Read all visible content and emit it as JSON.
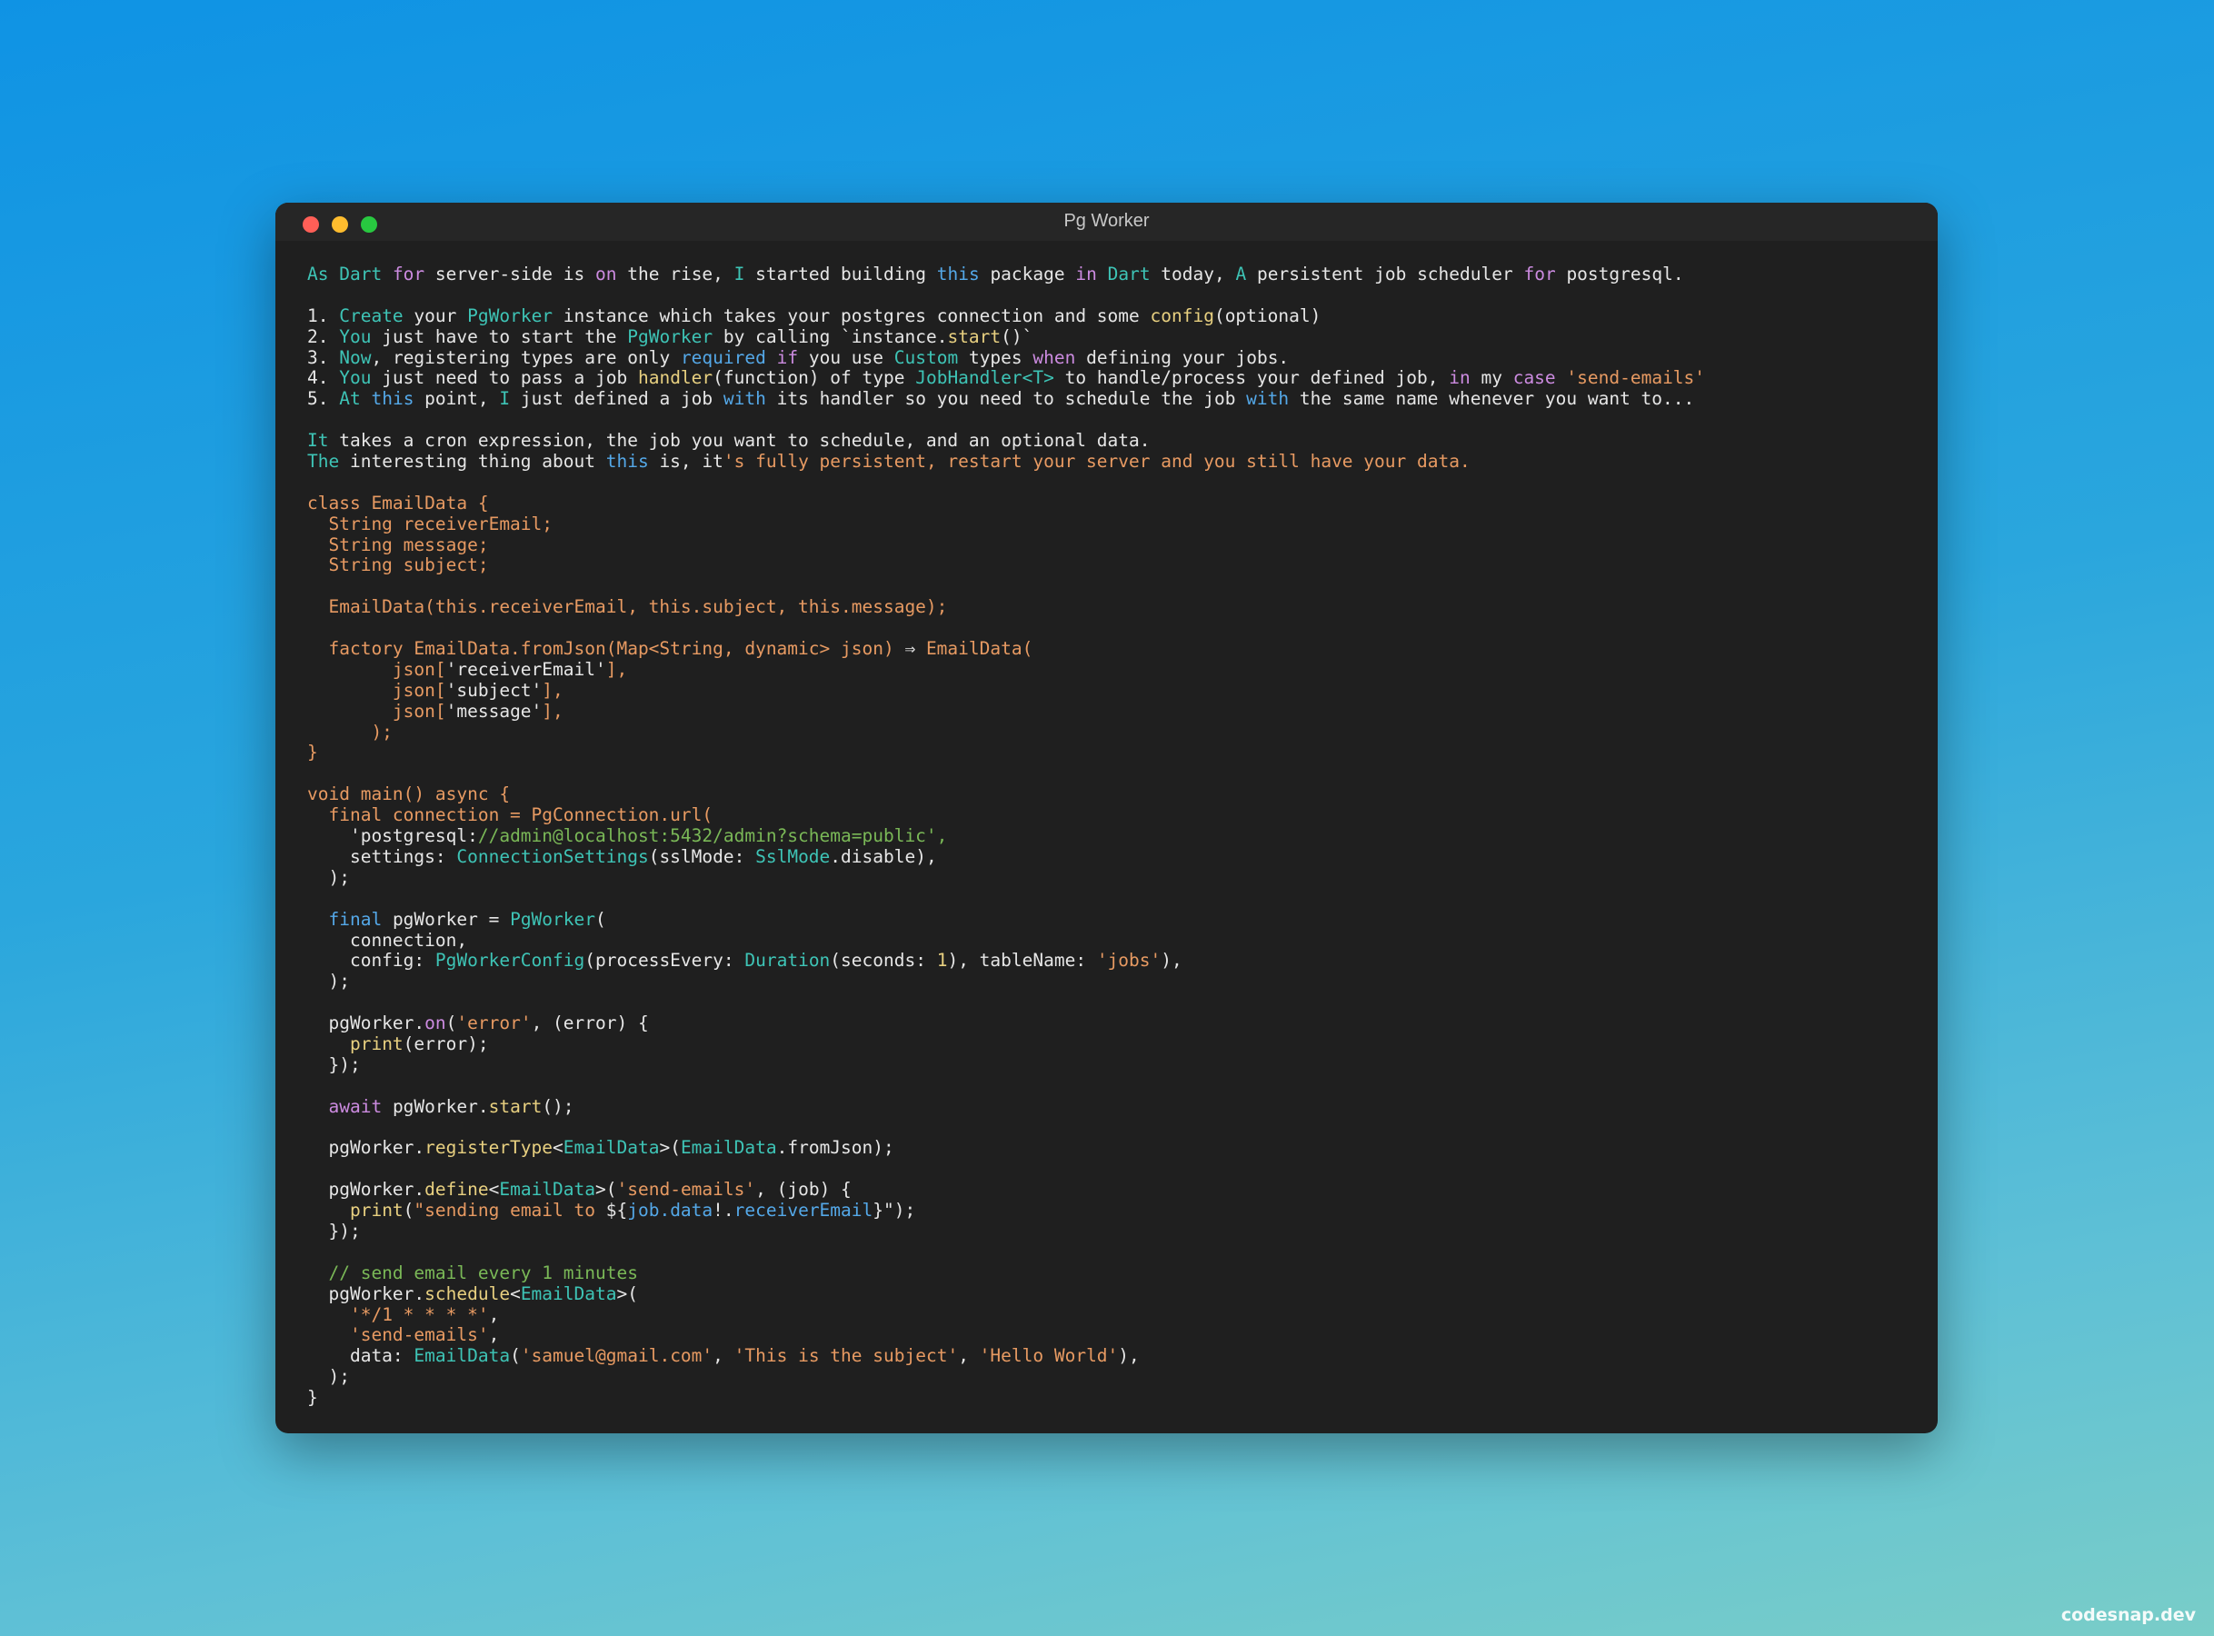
{
  "window": {
    "title": "Pg Worker"
  },
  "watermark": "codesnap.dev",
  "colors": {
    "background_top": "#0f93e4",
    "background_bottom": "#79cdc8",
    "window_bg": "#1f1f1f",
    "close": "#ff5f57",
    "minimize": "#febc2e",
    "maximize": "#28c840",
    "keyword": "#cc8be0",
    "type": "#3ec4b6",
    "string": "#e79a62",
    "comment": "#7ab857"
  },
  "code_lines": [
    [
      [
        "As ",
        "teal"
      ],
      [
        "Dart ",
        "teal"
      ],
      [
        "for ",
        "kw"
      ],
      [
        "server-side is ",
        "white"
      ],
      [
        "on ",
        "kw"
      ],
      [
        "the rise, ",
        "white"
      ],
      [
        "I ",
        "teal"
      ],
      [
        "started building ",
        "white"
      ],
      [
        "this ",
        "blue"
      ],
      [
        "package ",
        "white"
      ],
      [
        "in ",
        "kw"
      ],
      [
        "Dart ",
        "teal"
      ],
      [
        "today, ",
        "white"
      ],
      [
        "A ",
        "teal"
      ],
      [
        "persistent job scheduler ",
        "white"
      ],
      [
        "for ",
        "kw"
      ],
      [
        "postgresql.",
        "white"
      ]
    ],
    [],
    [
      [
        "1. ",
        "white"
      ],
      [
        "Create ",
        "teal"
      ],
      [
        "your ",
        "white"
      ],
      [
        "PgWorker ",
        "teal"
      ],
      [
        "instance which takes your postgres connection and some ",
        "white"
      ],
      [
        "config",
        "yellow"
      ],
      [
        "(optional)",
        "white"
      ]
    ],
    [
      [
        "2. ",
        "white"
      ],
      [
        "You ",
        "teal"
      ],
      [
        "just have to start the ",
        "white"
      ],
      [
        "PgWorker ",
        "teal"
      ],
      [
        "by calling `instance.",
        "white"
      ],
      [
        "start",
        "yellow"
      ],
      [
        "()`",
        "white"
      ]
    ],
    [
      [
        "3. ",
        "white"
      ],
      [
        "Now",
        "teal"
      ],
      [
        ", registering types are only ",
        "white"
      ],
      [
        "required ",
        "blue"
      ],
      [
        "if ",
        "kw"
      ],
      [
        "you use ",
        "white"
      ],
      [
        "Custom ",
        "teal"
      ],
      [
        "types ",
        "white"
      ],
      [
        "when ",
        "kw"
      ],
      [
        "defining your jobs.",
        "white"
      ]
    ],
    [
      [
        "4. ",
        "white"
      ],
      [
        "You ",
        "teal"
      ],
      [
        "just need to pass a job ",
        "white"
      ],
      [
        "handler",
        "yellow"
      ],
      [
        "(function) of type ",
        "white"
      ],
      [
        "JobHandler<T> ",
        "teal"
      ],
      [
        "to handle/process your defined job, ",
        "white"
      ],
      [
        "in ",
        "kw"
      ],
      [
        "my ",
        "white"
      ],
      [
        "case ",
        "kw"
      ],
      [
        "'send-emails'",
        "orange"
      ]
    ],
    [
      [
        "5. ",
        "white"
      ],
      [
        "At ",
        "teal"
      ],
      [
        "this ",
        "blue"
      ],
      [
        "point, ",
        "white"
      ],
      [
        "I ",
        "teal"
      ],
      [
        "just defined a job ",
        "white"
      ],
      [
        "with ",
        "blue"
      ],
      [
        "its handler so you need to schedule the job ",
        "white"
      ],
      [
        "with ",
        "blue"
      ],
      [
        "the same name whenever you want to...",
        "white"
      ]
    ],
    [],
    [
      [
        "It ",
        "teal"
      ],
      [
        "takes a cron expression, the job you want to schedule, and an optional data.",
        "white"
      ]
    ],
    [
      [
        "The ",
        "teal"
      ],
      [
        "interesting thing about ",
        "white"
      ],
      [
        "this ",
        "blue"
      ],
      [
        "is, it",
        "white"
      ],
      [
        "'s fully persistent, restart your server and you still have your data.",
        "orange"
      ]
    ],
    [],
    [
      [
        "class EmailData {",
        "orange"
      ]
    ],
    [
      [
        "  String receiverEmail;",
        "orange"
      ]
    ],
    [
      [
        "  String message;",
        "orange"
      ]
    ],
    [
      [
        "  String subject;",
        "orange"
      ]
    ],
    [],
    [
      [
        "  EmailData(this.receiverEmail, this.subject, this.message);",
        "orange"
      ]
    ],
    [],
    [
      [
        "  factory EmailData.fromJson(Map<String, dynamic> json) ",
        "orange"
      ],
      [
        "⇒ ",
        "white"
      ],
      [
        "EmailData(",
        "orange"
      ]
    ],
    [
      [
        "        json[",
        "orange"
      ],
      [
        "'receiverEmail'",
        "white"
      ],
      [
        "],",
        "orange"
      ]
    ],
    [
      [
        "        json[",
        "orange"
      ],
      [
        "'subject'",
        "white"
      ],
      [
        "],",
        "orange"
      ]
    ],
    [
      [
        "        json[",
        "orange"
      ],
      [
        "'message'",
        "white"
      ],
      [
        "],",
        "orange"
      ]
    ],
    [
      [
        "      );",
        "orange"
      ]
    ],
    [
      [
        "}",
        "orange"
      ]
    ],
    [],
    [
      [
        "void main() async {",
        "orange"
      ]
    ],
    [
      [
        "  final connection = PgConnection.url(",
        "orange"
      ]
    ],
    [
      [
        "    'postgresql:",
        "white"
      ],
      [
        "//admin@localhost:5432/admin?schema=public',",
        "green"
      ]
    ],
    [
      [
        "    settings: ",
        "white"
      ],
      [
        "ConnectionSettings",
        "teal"
      ],
      [
        "(sslMode: ",
        "white"
      ],
      [
        "SslMode",
        "teal"
      ],
      [
        ".disable),",
        "white"
      ]
    ],
    [
      [
        "  );",
        "white"
      ]
    ],
    [],
    [
      [
        "  ",
        "white"
      ],
      [
        "final ",
        "blue"
      ],
      [
        "pgWorker = ",
        "white"
      ],
      [
        "PgWorker",
        "teal"
      ],
      [
        "(",
        "white"
      ]
    ],
    [
      [
        "    connection,",
        "white"
      ]
    ],
    [
      [
        "    config: ",
        "white"
      ],
      [
        "PgWorkerConfig",
        "teal"
      ],
      [
        "(processEvery: ",
        "white"
      ],
      [
        "Duration",
        "teal"
      ],
      [
        "(seconds: ",
        "white"
      ],
      [
        "1",
        "yellow"
      ],
      [
        "), tableName: ",
        "white"
      ],
      [
        "'jobs'",
        "orange"
      ],
      [
        "),",
        "white"
      ]
    ],
    [
      [
        "  );",
        "white"
      ]
    ],
    [],
    [
      [
        "  pgWorker.",
        "white"
      ],
      [
        "on",
        "kw"
      ],
      [
        "(",
        "white"
      ],
      [
        "'error'",
        "orange"
      ],
      [
        ", (error) {",
        "white"
      ]
    ],
    [
      [
        "    ",
        "white"
      ],
      [
        "print",
        "yellow"
      ],
      [
        "(error);",
        "white"
      ]
    ],
    [
      [
        "  });",
        "white"
      ]
    ],
    [],
    [
      [
        "  ",
        "white"
      ],
      [
        "await ",
        "kw"
      ],
      [
        "pgWorker.",
        "white"
      ],
      [
        "start",
        "yellow"
      ],
      [
        "();",
        "white"
      ]
    ],
    [],
    [
      [
        "  pgWorker.",
        "white"
      ],
      [
        "registerType",
        "yellow"
      ],
      [
        "<",
        "white"
      ],
      [
        "EmailData",
        "teal"
      ],
      [
        ">(",
        "white"
      ],
      [
        "EmailData",
        "teal"
      ],
      [
        ".fromJson);",
        "white"
      ]
    ],
    [],
    [
      [
        "  pgWorker.",
        "white"
      ],
      [
        "define",
        "yellow"
      ],
      [
        "<",
        "white"
      ],
      [
        "EmailData",
        "teal"
      ],
      [
        ">(",
        "white"
      ],
      [
        "'send-emails'",
        "orange"
      ],
      [
        ", (job) {",
        "white"
      ]
    ],
    [
      [
        "    ",
        "white"
      ],
      [
        "print",
        "yellow"
      ],
      [
        "(",
        "white"
      ],
      [
        "\"sending email to ",
        "orange"
      ],
      [
        "${",
        "white"
      ],
      [
        "job.data",
        "blue"
      ],
      [
        "!.",
        "white"
      ],
      [
        "receiverEmail",
        "blue"
      ],
      [
        "}\"",
        "white"
      ],
      [
        ");",
        "white"
      ]
    ],
    [
      [
        "  });",
        "white"
      ]
    ],
    [],
    [
      [
        "  // send email every 1 minutes",
        "green"
      ]
    ],
    [
      [
        "  pgWorker.",
        "white"
      ],
      [
        "schedule",
        "yellow"
      ],
      [
        "<",
        "white"
      ],
      [
        "EmailData",
        "teal"
      ],
      [
        ">(",
        "white"
      ]
    ],
    [
      [
        "    ",
        "white"
      ],
      [
        "'*/1 * * * *'",
        "orange"
      ],
      [
        ",",
        "white"
      ]
    ],
    [
      [
        "    ",
        "white"
      ],
      [
        "'send-emails'",
        "orange"
      ],
      [
        ",",
        "white"
      ]
    ],
    [
      [
        "    data: ",
        "white"
      ],
      [
        "EmailData",
        "teal"
      ],
      [
        "(",
        "white"
      ],
      [
        "'samuel@gmail.com'",
        "orange"
      ],
      [
        ", ",
        "white"
      ],
      [
        "'This is the subject'",
        "orange"
      ],
      [
        ", ",
        "white"
      ],
      [
        "'Hello World'",
        "orange"
      ],
      [
        "),",
        "white"
      ]
    ],
    [
      [
        "  );",
        "white"
      ]
    ],
    [
      [
        "}",
        "white"
      ]
    ]
  ]
}
